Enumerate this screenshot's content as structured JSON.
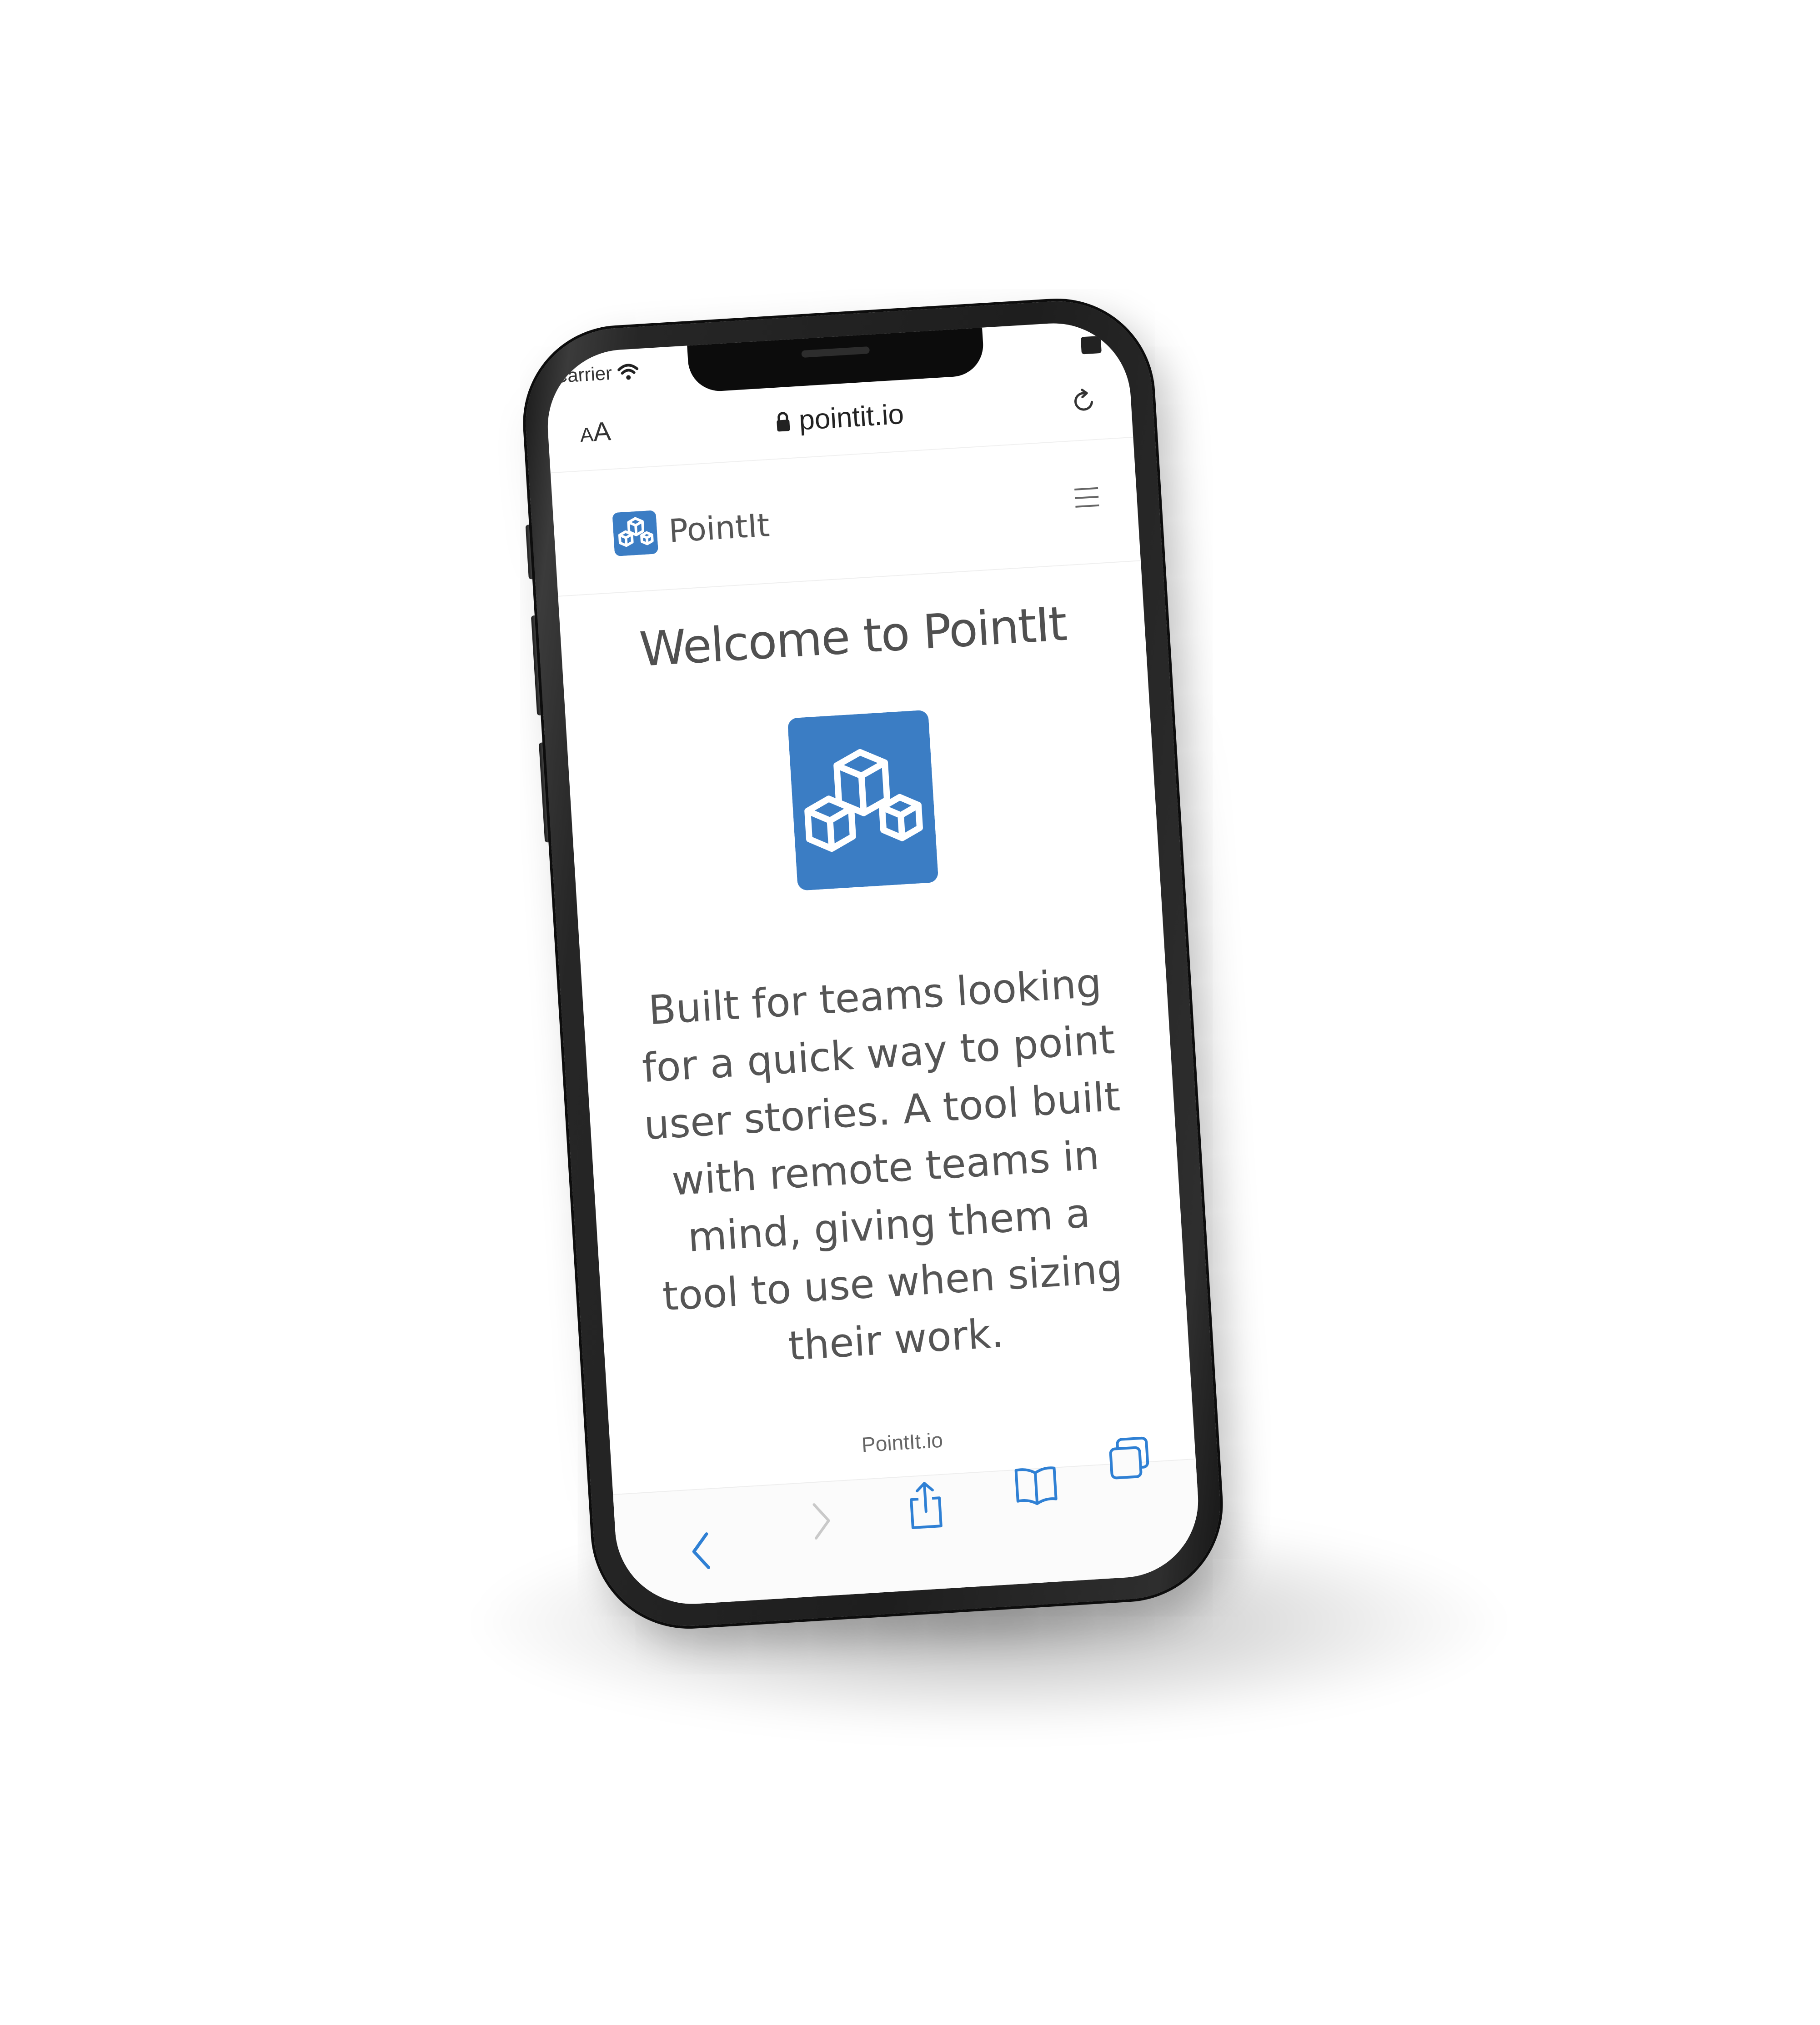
{
  "status_bar": {
    "carrier": "Carrier"
  },
  "browser": {
    "text_size_label_small": "A",
    "text_size_label_large": "A",
    "url": "pointit.io"
  },
  "site_nav": {
    "brand_name": "PointIt"
  },
  "main": {
    "title": "Welcome to PointIt",
    "description": "Built for teams looking for a quick way to point user stories. A tool built with remote teams in mind, giving them a tool to use when sizing their work."
  },
  "footer": {
    "text": "PointIt.io"
  },
  "colors": {
    "brand_blue": "#3B7DC4",
    "toolbar_blue": "#2F80D4",
    "frame": "#222222",
    "text": "#555555"
  },
  "icons": {
    "logo": "cubes-logo-icon",
    "menu": "hamburger-menu-icon",
    "reload": "reload-icon",
    "lock": "lock-icon",
    "wifi": "wifi-icon",
    "battery": "battery-icon",
    "back": "chevron-left-icon",
    "forward": "chevron-right-icon",
    "share": "share-icon",
    "bookmarks": "bookmarks-icon",
    "tabs": "tabs-icon"
  }
}
